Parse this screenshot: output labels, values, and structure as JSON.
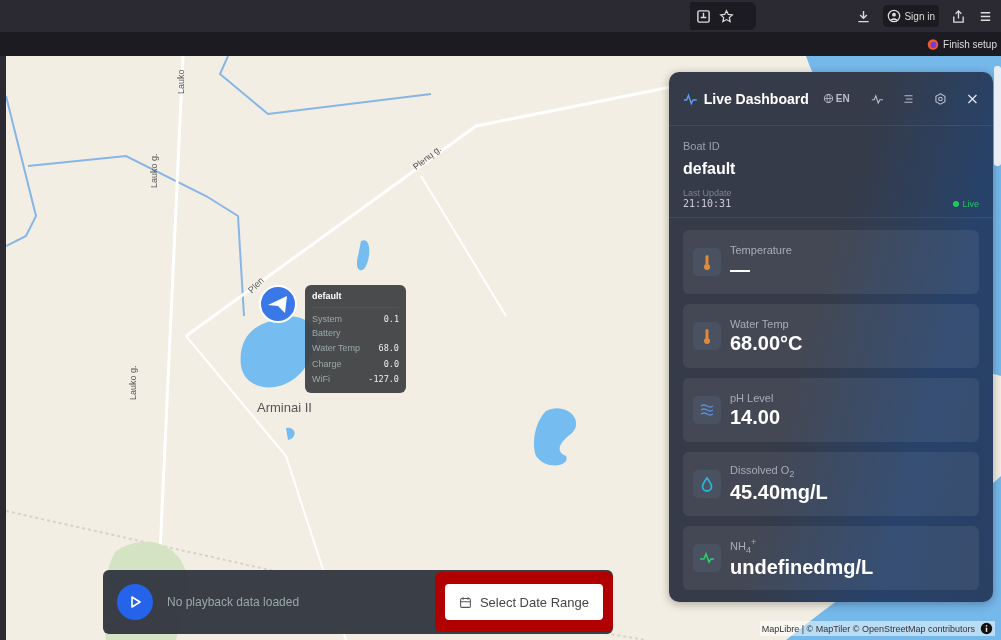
{
  "browser": {
    "sign_in": "Sign in",
    "finish_setup": "Finish setup"
  },
  "map": {
    "labels": [
      {
        "text": "Lauko"
      },
      {
        "text": "Lauko g."
      },
      {
        "text": "Plenų g."
      },
      {
        "text": "Plen"
      },
      {
        "text": "Arminai II"
      },
      {
        "text": "Lauko g."
      }
    ],
    "attribution": "MapLibre | © MapTiler © OpenStreetMap contributors"
  },
  "marker_popup": {
    "title": "default",
    "rows": [
      {
        "label": "System Battery",
        "value": "0.1"
      },
      {
        "label": "Water Temp",
        "value": "68.0"
      },
      {
        "label": "Charge",
        "value": "0.0"
      },
      {
        "label": "WiFi",
        "value": "-127.0"
      }
    ]
  },
  "dashboard": {
    "title": "Live Dashboard",
    "language": "EN",
    "boat_id_label": "Boat ID",
    "boat_id": "default",
    "last_update_label": "Last Update",
    "last_update": "21:10:31",
    "status": {
      "text": "Live",
      "color": "#22c55e"
    },
    "metrics": [
      {
        "kind": "thermometer",
        "label": "Temperature",
        "value": "—"
      },
      {
        "kind": "thermometer",
        "label": "Water Temp",
        "value": "68.00°C"
      },
      {
        "kind": "waves",
        "label": "pH Level",
        "value": "14.00"
      },
      {
        "kind": "drop",
        "label": "Dissolved O$_{2}$",
        "value": "45.40mg/L"
      },
      {
        "kind": "pulse",
        "label": "NH$_{4}$$^{+}$",
        "value": "undefinedmg/L"
      }
    ]
  },
  "playback": {
    "message": "No playback data loaded",
    "button": "Select Date Range",
    "highlighted": true
  }
}
